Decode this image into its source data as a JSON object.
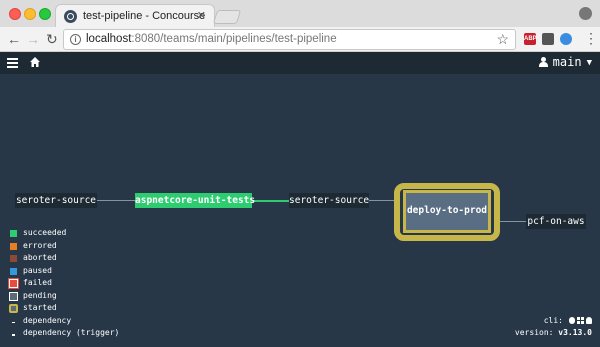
{
  "browser": {
    "tab_title": "test-pipeline - Concourse",
    "tab_close": "✕",
    "url_host": "localhost",
    "url_rest": ":8080/teams/main/pipelines/test-pipeline",
    "ext_abp": "ABP"
  },
  "topbar": {
    "user": "main"
  },
  "pipeline": {
    "source_left": "seroter-source",
    "job_tests": "aspnetcore-unit-tests",
    "source_mid": "seroter-source",
    "job_deploy": "deploy-to-prod",
    "output": "pcf-on-aws"
  },
  "legend": {
    "items": [
      "succeeded",
      "errored",
      "aborted",
      "paused",
      "failed",
      "pending",
      "started",
      "dependency",
      "dependency (trigger)"
    ]
  },
  "footer": {
    "cli_label": "cli:",
    "version_label": "version:",
    "version_value": "v3.13.0"
  },
  "colors": {
    "succeeded": "#2ecc71",
    "errored": "#e67e22",
    "aborted": "#8b4a35",
    "paused": "#3498db",
    "failed": "#e74c3c",
    "started": "#c7b74a",
    "canvas": "#273747",
    "topbar": "#1e2a33"
  }
}
